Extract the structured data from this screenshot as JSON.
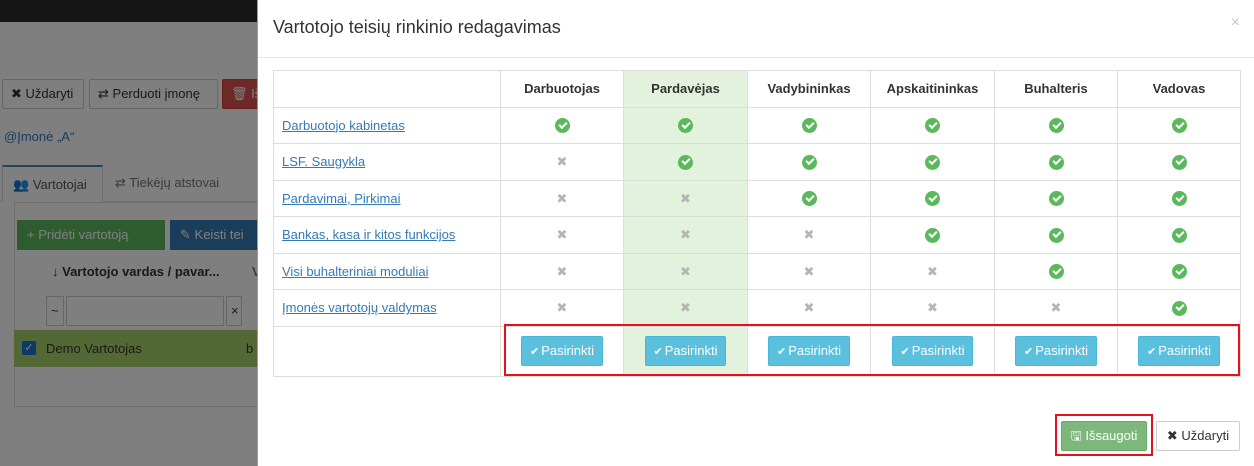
{
  "background": {
    "toolbar": {
      "close_label": "Uždaryti",
      "transfer_label": "Perduoti įmonę",
      "danger_label": "Iš"
    },
    "company_link": "Įmonė „A“",
    "tabs": [
      {
        "label": "Vartotojai"
      },
      {
        "label": "Tiekėjų atstovai"
      }
    ],
    "add_user_label": "Pridėti vartotoją",
    "edit_label": "Keisti tei",
    "column_header": "Vartotojo vardas / pavar...",
    "column_header_2": "V",
    "filter_op": "~",
    "filter_clear": "×",
    "selected_row": {
      "name": "Demo Vartotojas",
      "extra": "b"
    }
  },
  "modal": {
    "title": "Vartotojo teisių rinkinio redagavimas",
    "close_glyph": "×",
    "columns": [
      "Darbuotojas",
      "Pardavėjas",
      "Vadybininkas",
      "Apskaitininkas",
      "Buhalteris",
      "Vadovas"
    ],
    "highlight_column": 1,
    "rows": [
      {
        "name": "Darbuotojo kabinetas",
        "perms": [
          true,
          true,
          true,
          true,
          true,
          true
        ]
      },
      {
        "name": "LSF. Saugykla",
        "perms": [
          false,
          true,
          true,
          true,
          true,
          true
        ]
      },
      {
        "name": "Pardavimai, Pirkimai",
        "perms": [
          false,
          false,
          true,
          true,
          true,
          true
        ]
      },
      {
        "name": "Bankas, kasa ir kitos funkcijos",
        "perms": [
          false,
          false,
          false,
          true,
          true,
          true
        ]
      },
      {
        "name": "Visi buhalteriniai moduliai",
        "perms": [
          false,
          false,
          false,
          false,
          true,
          true
        ]
      },
      {
        "name": "Įmonės vartotojų valdymas",
        "perms": [
          false,
          false,
          false,
          false,
          false,
          true
        ]
      }
    ],
    "pick_label": "Pasirinkti",
    "save_label": "Išsaugoti",
    "cancel_label": "Uždaryti"
  },
  "colors": {
    "highlight": "#e2f2dc",
    "ok": "#5cb85c",
    "pick_button": "#5bc0de",
    "save_button": "#7cb87c",
    "annotation": "#e0121d"
  }
}
